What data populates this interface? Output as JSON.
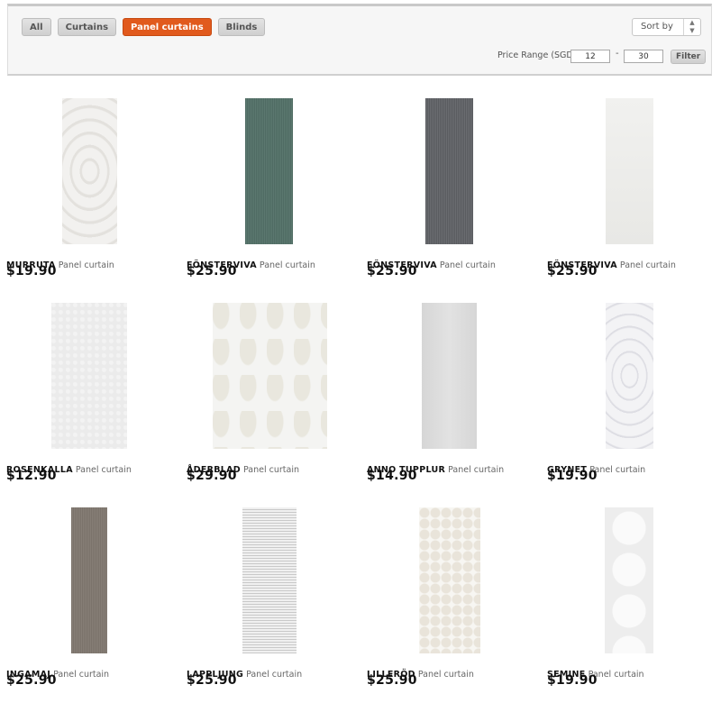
{
  "filters": {
    "tabs": [
      {
        "label": "All",
        "active": false
      },
      {
        "label": "Curtains",
        "active": false
      },
      {
        "label": "Panel curtains",
        "active": true
      },
      {
        "label": "Blinds",
        "active": false
      }
    ],
    "sort_label": "Sort by",
    "price_range_label": "Price Range (SGD)",
    "price_min": "12",
    "price_max": "30",
    "dash": "-",
    "filter_button": "Filter"
  },
  "colors": {
    "accent": "#e15a1d"
  },
  "products": [
    {
      "name": "MURRUTA",
      "type": "Panel curtain",
      "price": "$19.90",
      "swatch": "murruta"
    },
    {
      "name": "FÖNSTERVIVA",
      "type": "Panel curtain",
      "price": "$25.90",
      "swatch": "green"
    },
    {
      "name": "FÖNSTERVIVA",
      "type": "Panel curtain",
      "price": "$25.90",
      "swatch": "darkgray"
    },
    {
      "name": "FÖNSTERVIVA",
      "type": "Panel curtain",
      "price": "$25.90",
      "swatch": "white"
    },
    {
      "name": "ROSENKALLA",
      "type": "Panel curtain",
      "price": "$12.90",
      "swatch": "rosenkalla"
    },
    {
      "name": "ÅDERBLAD",
      "type": "Panel curtain",
      "price": "$29.90",
      "swatch": "aderblad"
    },
    {
      "name": "ANNO TUPPLUR",
      "type": "Panel curtain",
      "price": "$14.90",
      "swatch": "anno"
    },
    {
      "name": "GRYNET",
      "type": "Panel curtain",
      "price": "$19.90",
      "swatch": "grynet"
    },
    {
      "name": "INGAMAJ",
      "type": "Panel curtain",
      "price": "$25.90",
      "swatch": "ingamaj"
    },
    {
      "name": "LAPPLJUNG",
      "type": "Panel curtain",
      "price": "$25.90",
      "swatch": "lappljung"
    },
    {
      "name": "LILLERÖD",
      "type": "Panel curtain",
      "price": "$25.90",
      "swatch": "lillerod"
    },
    {
      "name": "SEMINE",
      "type": "Panel curtain",
      "price": "$19.90",
      "swatch": "semine"
    }
  ]
}
